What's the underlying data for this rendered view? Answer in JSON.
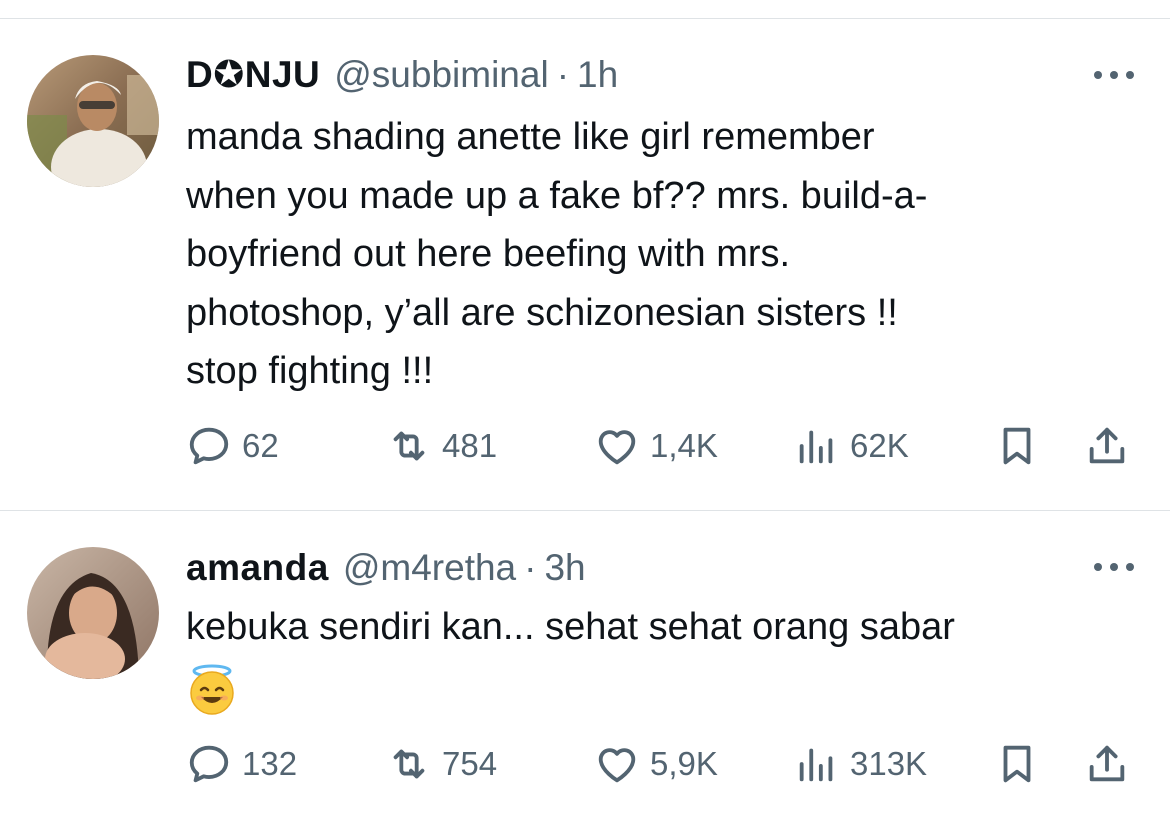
{
  "tweets": [
    {
      "display_name": "D✪NJU",
      "handle": "@subbiminal",
      "separator": "·",
      "time": "1h",
      "text_lines": [
        "manda shading anette like girl remember",
        "when you made up a fake bf?? mrs. build-a-",
        "boyfriend out here beefing with mrs.",
        "photoshop, y’all are schizonesian sisters !!",
        "stop fighting !!!"
      ],
      "replies": "62",
      "retweets": "481",
      "likes": "1,4K",
      "views": "62K"
    },
    {
      "display_name": "amanda",
      "handle": "@m4retha",
      "separator": "·",
      "time": "3h",
      "text_lines": [
        "kebuka sendiri kan... sehat sehat orang sabar"
      ],
      "emoji": "smiling-face-with-halo",
      "replies": "132",
      "retweets": "754",
      "likes": "5,9K",
      "views": "313K"
    }
  ],
  "icons": {
    "reply": "reply-icon",
    "retweet": "retweet-icon",
    "like": "heart-icon",
    "views": "views-icon",
    "bookmark": "bookmark-icon",
    "share": "share-icon",
    "more": "more-icon"
  },
  "colors": {
    "text": "#0f1419",
    "secondary": "#536471",
    "divider": "#dfe3e6"
  }
}
